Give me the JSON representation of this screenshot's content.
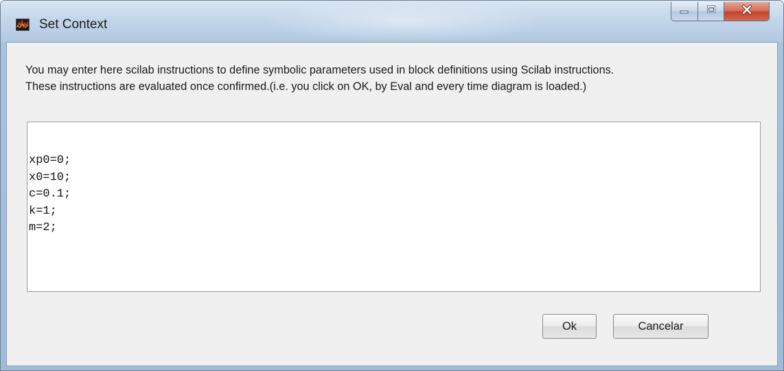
{
  "window": {
    "title": "Set Context",
    "icon": "scicos-app-icon",
    "controls": {
      "minimize": "minimize-icon",
      "maximize": "maximize-icon",
      "close": "close-icon"
    }
  },
  "instructions": {
    "line1": "You may enter here scilab instructions to define symbolic parameters used in block definitions using Scilab instructions.",
    "line2": "These instructions are evaluated once confirmed.(i.e.  you click on OK, by Eval and every time diagram is loaded.)"
  },
  "editor": {
    "lines": [
      "xp0=0;",
      "x0=10;",
      "c=0.1;",
      "k=1;",
      "m=2;"
    ]
  },
  "buttons": {
    "ok": "Ok",
    "cancel": "Cancelar"
  },
  "colors": {
    "frame": "#b2c9e2",
    "close_button": "#c9533b",
    "dialog_bg": "#f0f0f0"
  }
}
